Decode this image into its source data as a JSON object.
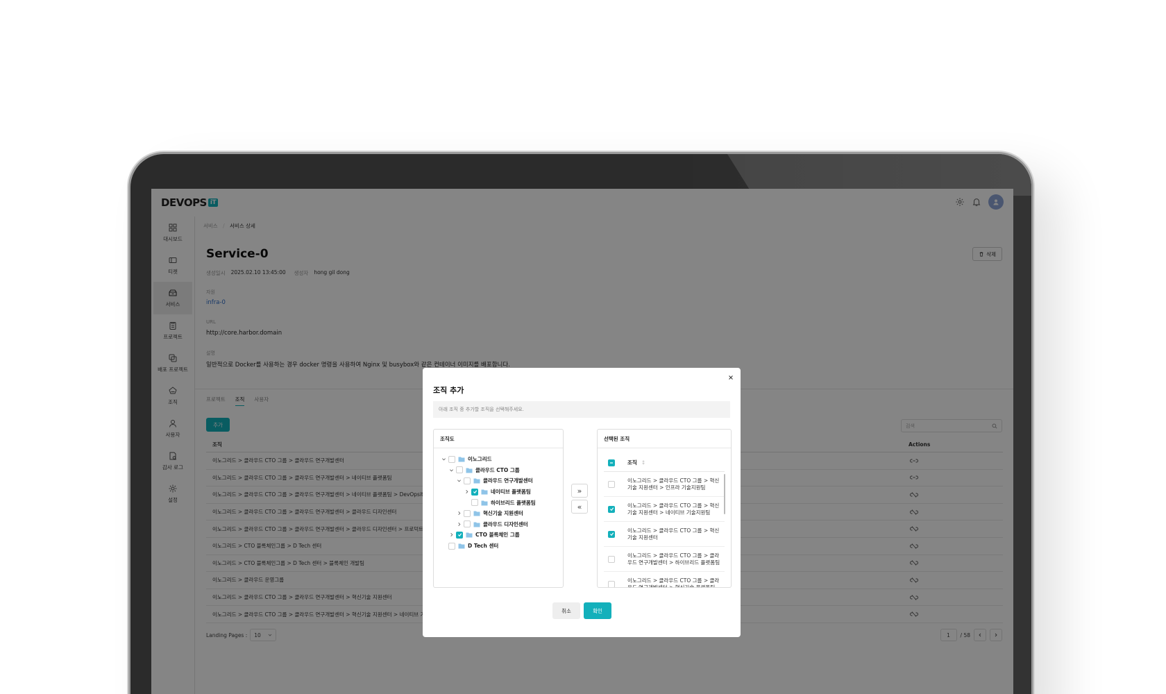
{
  "app": {
    "logo_main": "DEV",
    "logo_ops": "OPS",
    "logo_badge": "iT"
  },
  "sidebar": {
    "items": [
      {
        "label": "대시보드",
        "icon": "dashboard-icon"
      },
      {
        "label": "티켓",
        "icon": "ticket-icon"
      },
      {
        "label": "서비스",
        "icon": "service-icon"
      },
      {
        "label": "프로젝트",
        "icon": "project-icon"
      },
      {
        "label": "배포 프로젝트",
        "icon": "deploy-project-icon"
      },
      {
        "label": "조직",
        "icon": "organization-icon"
      },
      {
        "label": "사용자",
        "icon": "user-icon"
      },
      {
        "label": "감사 로그",
        "icon": "audit-log-icon"
      },
      {
        "label": "설정",
        "icon": "settings-icon"
      }
    ]
  },
  "breadcrumb": {
    "parent": "서비스",
    "separator": "/",
    "current": "서비스 상세"
  },
  "service": {
    "title": "Service-0",
    "created_label": "생성일시",
    "created_value": "2025.02.10 13:45:00",
    "creator_label": "생성자",
    "creator_value": "hong gil dong",
    "resource_label": "자원",
    "resource_value": "infra-0",
    "url_label": "URL",
    "url_value": "http://core.harbor.domain",
    "desc_label": "설명",
    "desc_value": "일반적으로 Docker를 사용하는 경우 docker 명령을 사용하여 Nginx 및 busybox와 같은 컨테이너 이미지를 배포합니다."
  },
  "delete_label": "삭제",
  "tabs": [
    "프로젝트",
    "조직",
    "사용자"
  ],
  "add_label": "추가",
  "search_placeholder": "검색",
  "table": {
    "col_org": "조직",
    "col_actions": "Actions",
    "rows": [
      "이노그리드 > 클라우드 CTO 그룹 > 클라우드 연구개발센터",
      "이노그리드 > 클라우드 CTO 그룹 > 클라우드 연구개발센터 > 네이티브 플랫폼팀",
      "이노그리드 > 클라우드 CTO 그룹 > 클라우드 연구개발센터 > 네이티브 플랫폼팀 > DevOpsit",
      "이노그리드 > 클라우드 CTO 그룹 > 클라우드 연구개발센터 > 클라우드 디자인센터",
      "이노그리드 > 클라우드 CTO 그룹 > 클라우드 연구개발센터 > 클라우드 디자인센터 > 프로덕트 디자인",
      "이노그리드 > CTO 블록체인그룹 > D Tech 센터",
      "이노그리드 > CTO 블록체인그룹 > D Tech 센터 > 블록체인 개발팀",
      "이노그리드 > 클라우드 운영그룹",
      "이노그리드 > 클라우드 CTO 그룹 > 클라우드 연구개발센터 > 혁신기술 지원센터",
      "이노그리드 > 클라우드 CTO 그룹 > 클라우드 연구개발센터 > 혁신기술 지원센터 > 네이티브 기술지원"
    ]
  },
  "pager": {
    "label": "Landing Pages :",
    "size": "10",
    "page": "1",
    "total": "/ 58"
  },
  "modal": {
    "title": "조직 추가",
    "hint": "아래 조직 중 추가할 조직을 선택해주세요.",
    "left_title": "조직도",
    "right_title": "선택된 조직",
    "right_col": "조직",
    "tree": [
      {
        "label": "이노그리드",
        "level": 0,
        "chev": "down",
        "checked": false
      },
      {
        "label": "클라우드 CTO 그룹",
        "level": 1,
        "chev": "down",
        "checked": false
      },
      {
        "label": "클라우드 연구개발센터",
        "level": 2,
        "chev": "down",
        "checked": false
      },
      {
        "label": "네이티브 플랫폼팀",
        "level": 3,
        "chev": "right",
        "checked": true
      },
      {
        "label": "하이브리드 플랫폼팀",
        "level": 3,
        "chev": "",
        "checked": false
      },
      {
        "label": "혁신기술 지원센터",
        "level": 2,
        "chev": "right",
        "checked": false
      },
      {
        "label": "클라우드 디자인센터",
        "level": 2,
        "chev": "right",
        "checked": false
      },
      {
        "label": "CTO 블록체인 그룹",
        "level": 1,
        "chev": "right",
        "checked": true
      },
      {
        "label": "D Tech 센터",
        "level": 0,
        "chev": "",
        "checked": false
      }
    ],
    "selected": [
      {
        "label": "이노그리드 > 클라우드 CTO 그룹 > 혁신기술 지원센터 > 인프라 기술지원팀",
        "checked": false
      },
      {
        "label": "이노그리드 > 클라우드 CTO 그룹 > 혁신기술 지원센터 > 네이티브 기술지원팀",
        "checked": true
      },
      {
        "label": "이노그리드 > 클라우드 CTO 그룹 > 혁신기술 지원센터",
        "checked": true
      },
      {
        "label": "이노그리드 > 클라우드 CTO 그룹 > 클라우드 연구개발센터 > 하이브리드 플랫폼팀",
        "checked": false
      },
      {
        "label": "이노그리드 > 클라우드 CTO 그룹 > 클라우드 연구개발센터 > 혁신기술 플랫폼팀",
        "checked": false
      }
    ],
    "move_right": "»",
    "move_left": "«",
    "cancel": "취소",
    "ok": "확인"
  },
  "colors": {
    "accent": "#13b0bb",
    "link": "#2d6cc7",
    "folder": "#8fc4e8"
  }
}
